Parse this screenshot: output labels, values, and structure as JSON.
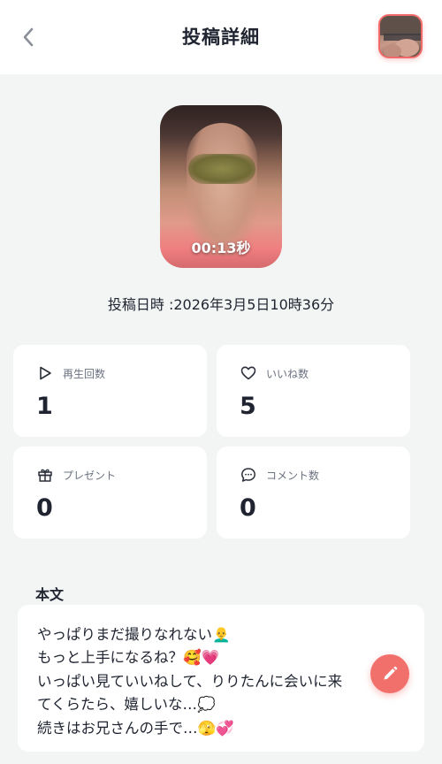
{
  "header": {
    "title": "投稿詳細"
  },
  "media": {
    "duration": "00:13秒"
  },
  "posted": {
    "text": "投稿日時 :2026年3月5日10時36分"
  },
  "stats": [
    {
      "icon": "play-icon",
      "label": "再生回数",
      "value": "1"
    },
    {
      "icon": "heart-icon",
      "label": "いいね数",
      "value": "5"
    },
    {
      "icon": "gift-icon",
      "label": "プレゼント",
      "value": "0"
    },
    {
      "icon": "comment-icon",
      "label": "コメント数",
      "value": "0"
    }
  ],
  "body": {
    "label": "本文",
    "lines": [
      "やっぱりまだ撮りなれない👨‍🦲",
      "もっと上手になるね？🥰💗",
      "いっぱい見ていいねして、りりたんに会いに来",
      "てくらたら、嬉しいな…💭",
      "続きはお兄さんの手で…🫣💞"
    ]
  },
  "colors": {
    "accent": "#f2706c",
    "background": "#f3f5f5",
    "card": "#ffffff",
    "text": "#1f2430",
    "muted": "#6b7280"
  }
}
